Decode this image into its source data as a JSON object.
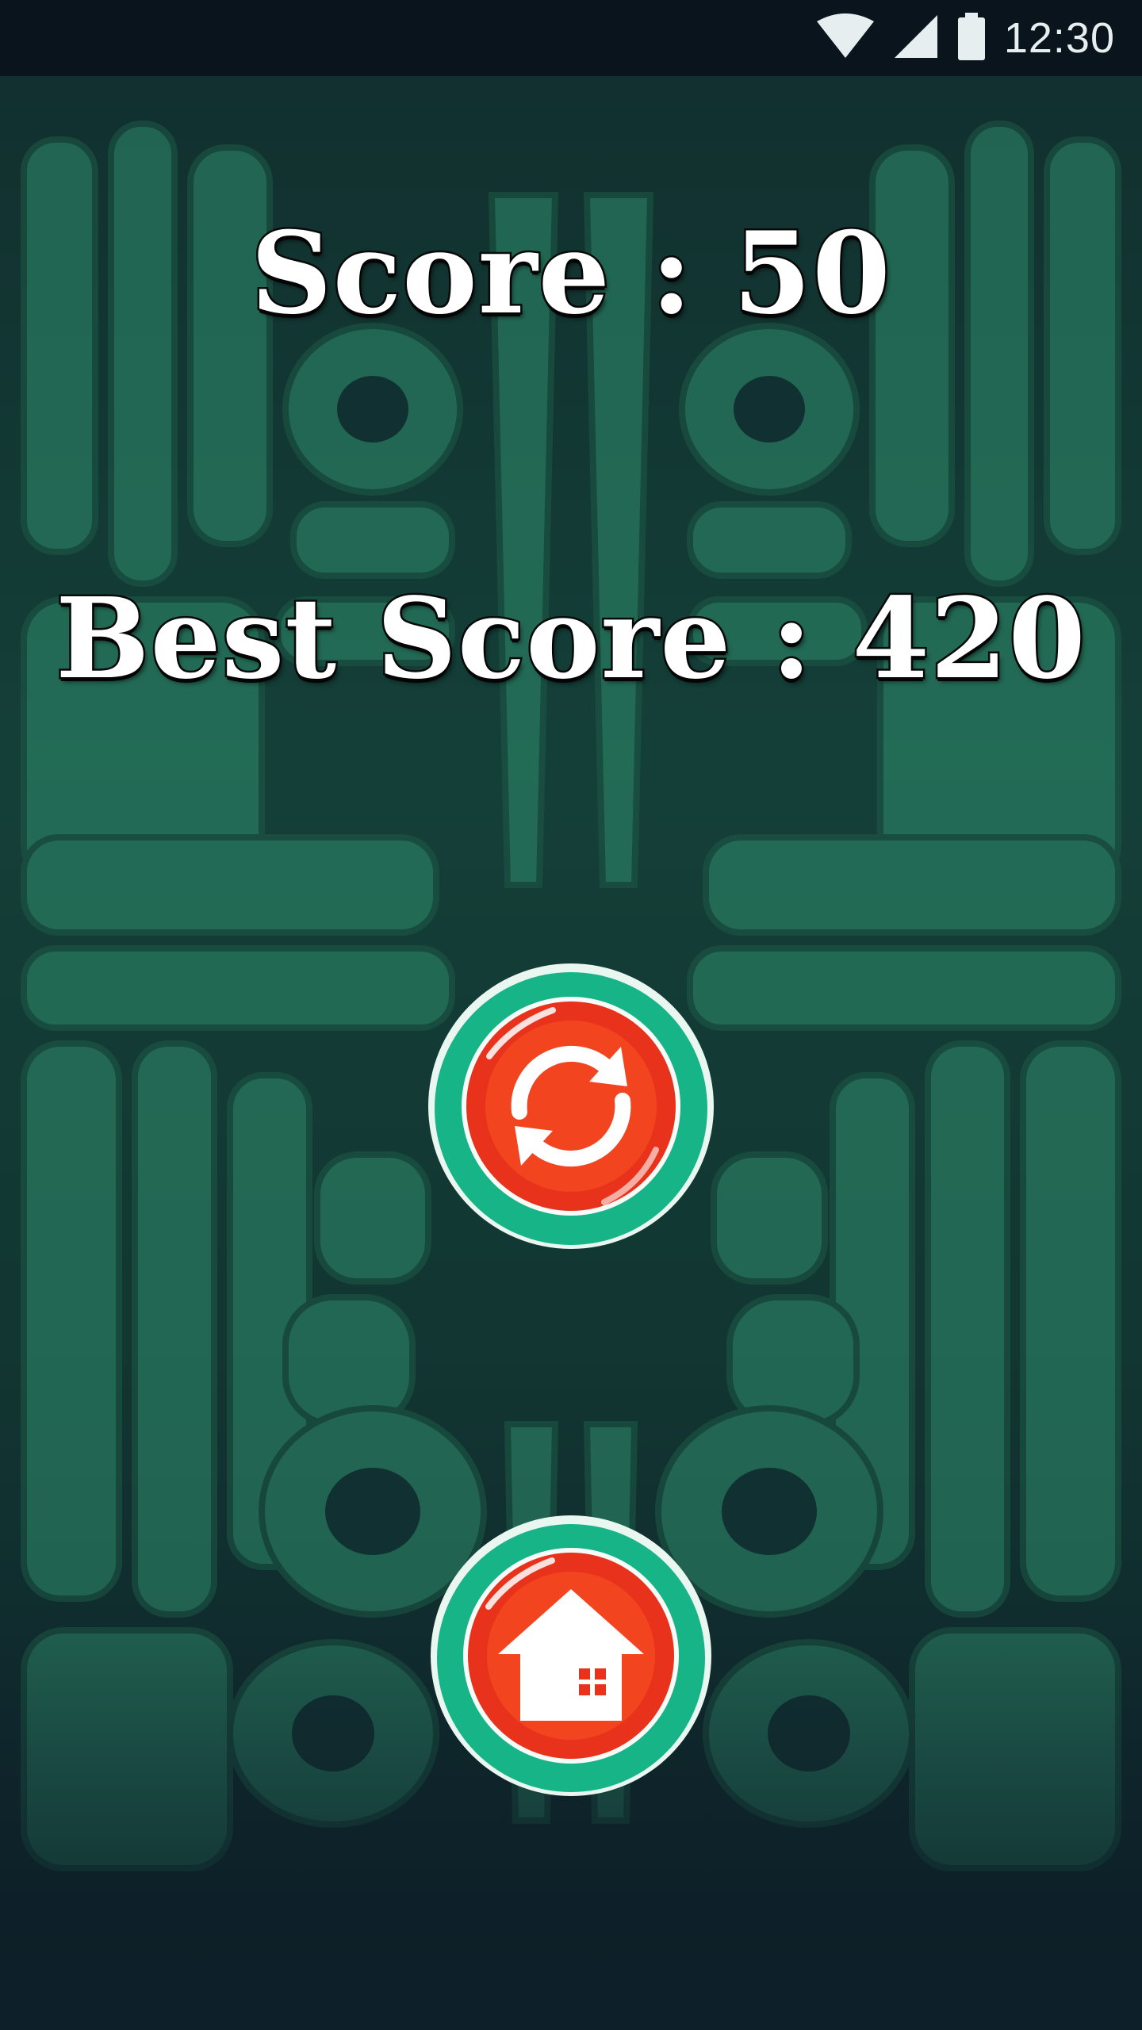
{
  "status_bar": {
    "time": "12:30",
    "icons": [
      "wifi-icon",
      "cell-signal-icon",
      "battery-icon"
    ]
  },
  "game_over": {
    "score_text": "Score : 50",
    "best_score_text": "Best Score : 420"
  },
  "buttons": {
    "replay_icon": "replay-icon",
    "home_icon": "home-icon"
  },
  "colors": {
    "button_rim": "#16b487",
    "button_face": "#e8321c",
    "icon": "#ffffff",
    "background_pattern": "#2f8f6e"
  }
}
